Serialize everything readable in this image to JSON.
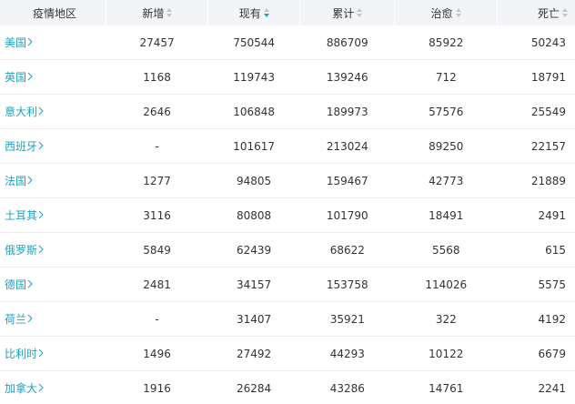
{
  "header": {
    "region": "疫情地区",
    "new": "新增",
    "current": "现有",
    "total": "累计",
    "cured": "治愈",
    "deaths": "死亡"
  },
  "colors": {
    "link": "#1aa3c4",
    "sort_active": "#1aa3c4",
    "sort_inactive": "#c0c4cc",
    "header_bg": "#f2f4f7"
  },
  "rows": [
    {
      "region": "美国",
      "new": "27457",
      "current": "750544",
      "total": "886709",
      "cured": "85922",
      "deaths": "50243"
    },
    {
      "region": "英国",
      "new": "1168",
      "current": "119743",
      "total": "139246",
      "cured": "712",
      "deaths": "18791"
    },
    {
      "region": "意大利",
      "new": "2646",
      "current": "106848",
      "total": "189973",
      "cured": "57576",
      "deaths": "25549"
    },
    {
      "region": "西班牙",
      "new": "-",
      "current": "101617",
      "total": "213024",
      "cured": "89250",
      "deaths": "22157"
    },
    {
      "region": "法国",
      "new": "1277",
      "current": "94805",
      "total": "159467",
      "cured": "42773",
      "deaths": "21889"
    },
    {
      "region": "土耳其",
      "new": "3116",
      "current": "80808",
      "total": "101790",
      "cured": "18491",
      "deaths": "2491"
    },
    {
      "region": "俄罗斯",
      "new": "5849",
      "current": "62439",
      "total": "68622",
      "cured": "5568",
      "deaths": "615"
    },
    {
      "region": "德国",
      "new": "2481",
      "current": "34157",
      "total": "153758",
      "cured": "114026",
      "deaths": "5575"
    },
    {
      "region": "荷兰",
      "new": "-",
      "current": "31407",
      "total": "35921",
      "cured": "322",
      "deaths": "4192"
    },
    {
      "region": "比利时",
      "new": "1496",
      "current": "27492",
      "total": "44293",
      "cured": "10122",
      "deaths": "6679"
    },
    {
      "region": "加拿大",
      "new": "1916",
      "current": "26284",
      "total": "43286",
      "cured": "14761",
      "deaths": "2241"
    }
  ]
}
